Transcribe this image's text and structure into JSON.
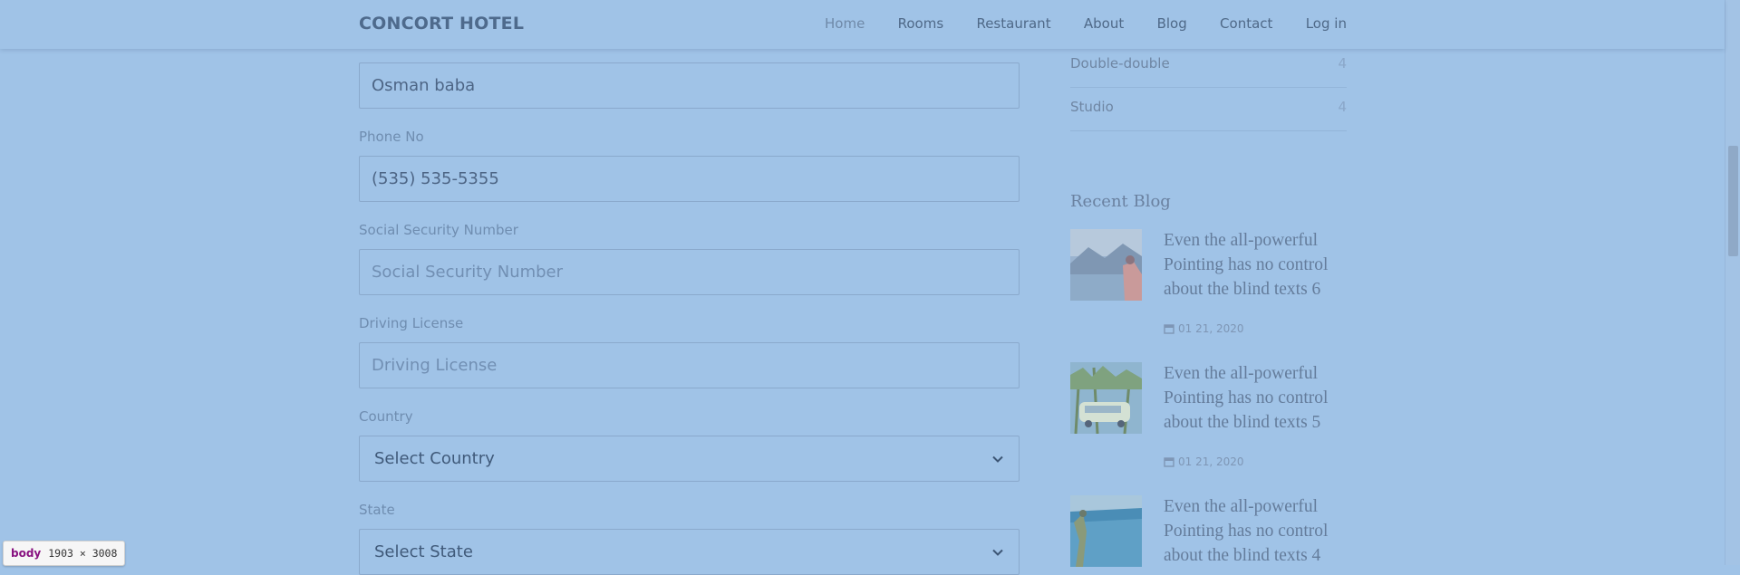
{
  "nav": {
    "brand": "CONCORT HOTEL",
    "links": [
      "Home",
      "Rooms",
      "Restaurant",
      "About",
      "Blog",
      "Contact",
      "Log in"
    ]
  },
  "form": {
    "name_value": "Osman baba",
    "phone_label": "Phone No",
    "phone_value": "(535) 535-5355",
    "ssn_label": "Social Security Number",
    "ssn_placeholder": "Social Security Number",
    "license_label": "Driving License",
    "license_placeholder": "Driving License",
    "country_label": "Country",
    "country_selected": "Select Country",
    "state_label": "State",
    "state_selected": "Select State"
  },
  "sidebar": {
    "categories": [
      {
        "name": "Double-double",
        "count": "4"
      },
      {
        "name": "Studio",
        "count": "4"
      }
    ],
    "recent_title": "Recent Blog",
    "posts": [
      {
        "title": "Even the all-powerful Pointing has no control about the blind texts 6",
        "date": "01 21, 2020"
      },
      {
        "title": "Even the all-powerful Pointing has no control about the blind texts 5",
        "date": "01 21, 2020"
      },
      {
        "title": "Even the all-powerful Pointing has no control about the blind texts 4",
        "date": ""
      }
    ]
  },
  "devtools": {
    "tag": "body",
    "size": "1903 × 3008"
  },
  "colors": {
    "overlay": "#a0c3e7",
    "brand": "#4e6a8c",
    "label": "#6f8db0"
  }
}
